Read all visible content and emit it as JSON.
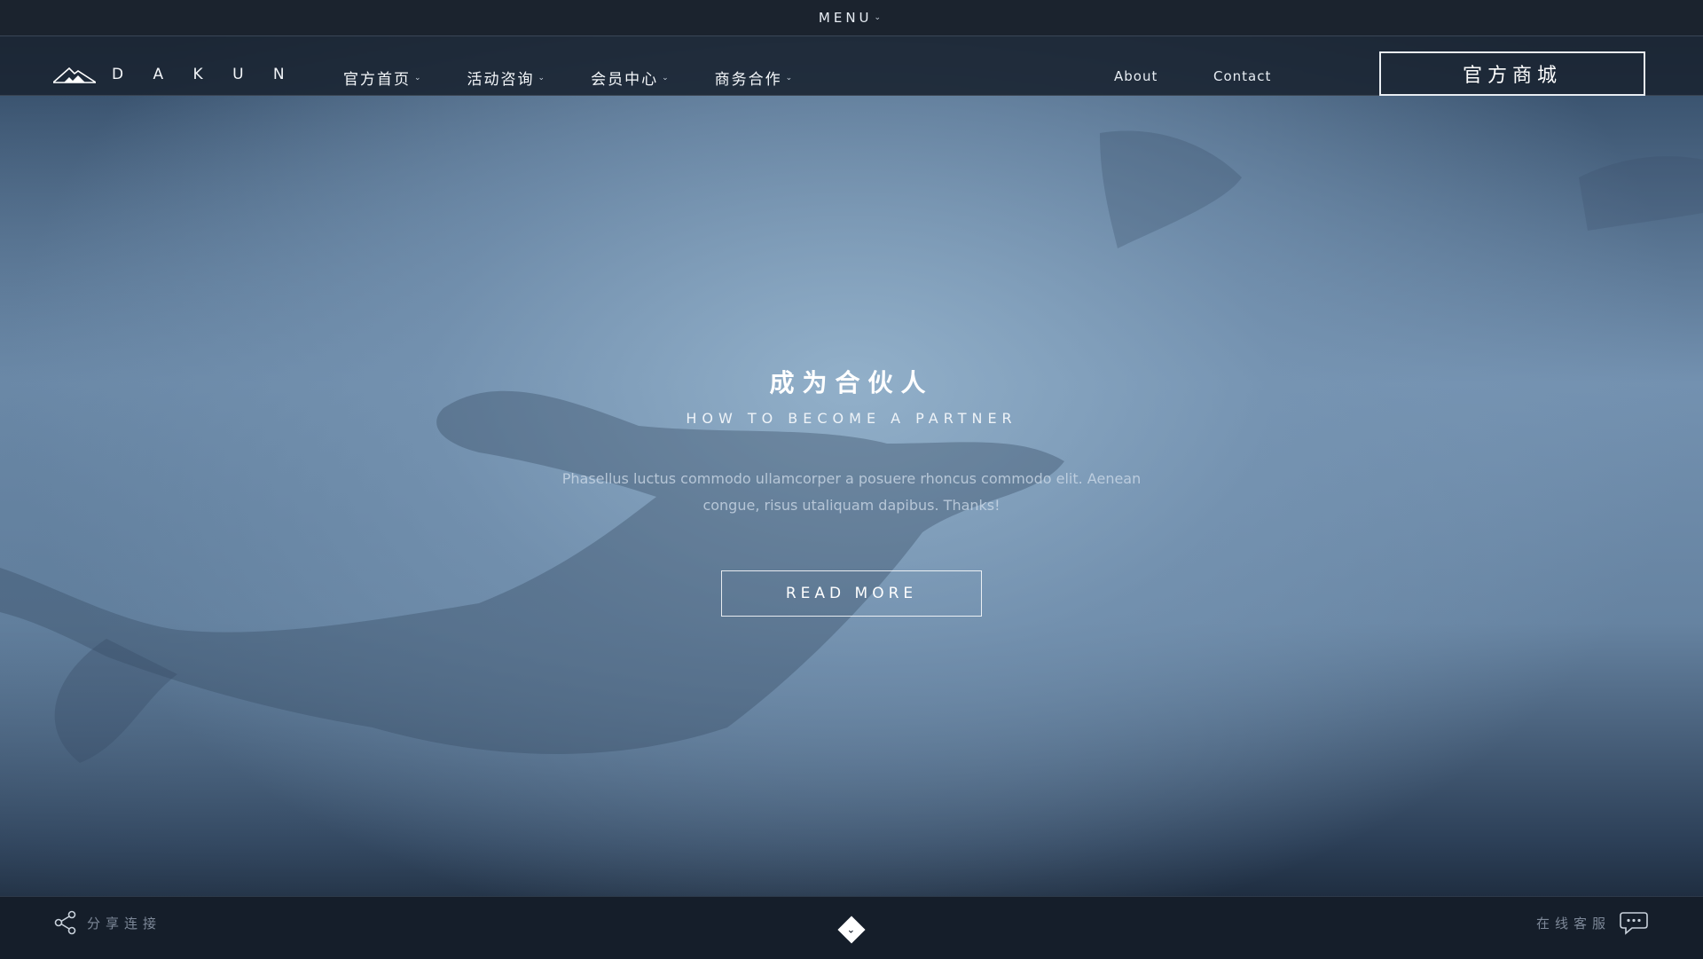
{
  "topbar": {
    "menu_label": "MENU"
  },
  "brand": {
    "name": "D A K U N"
  },
  "nav": {
    "items": [
      {
        "label": "官方首页"
      },
      {
        "label": "活动咨询"
      },
      {
        "label": "会员中心"
      },
      {
        "label": "商务合作"
      }
    ],
    "about": "About",
    "contact": "Contact",
    "shop_button": "官方商城"
  },
  "hero": {
    "title": "成为合伙人",
    "subtitle": "HOW TO BECOME A PARTNER",
    "description": "Phasellus luctus commodo ullamcorper a posuere rhoncus commodo elit. Aenean congue, risus utaliquam dapibus. Thanks!",
    "button": "READ MORE"
  },
  "footer": {
    "share_label": "分享连接",
    "service_label": "在线客服"
  },
  "icons": {
    "logo": "mountain-icon",
    "share": "share-icon",
    "chat": "chat-bubble-icon",
    "scroll": "chevron-down-icon"
  },
  "colors": {
    "topbar": "#1b232e",
    "footer": "#151e2a",
    "accent": "#ffffff"
  }
}
